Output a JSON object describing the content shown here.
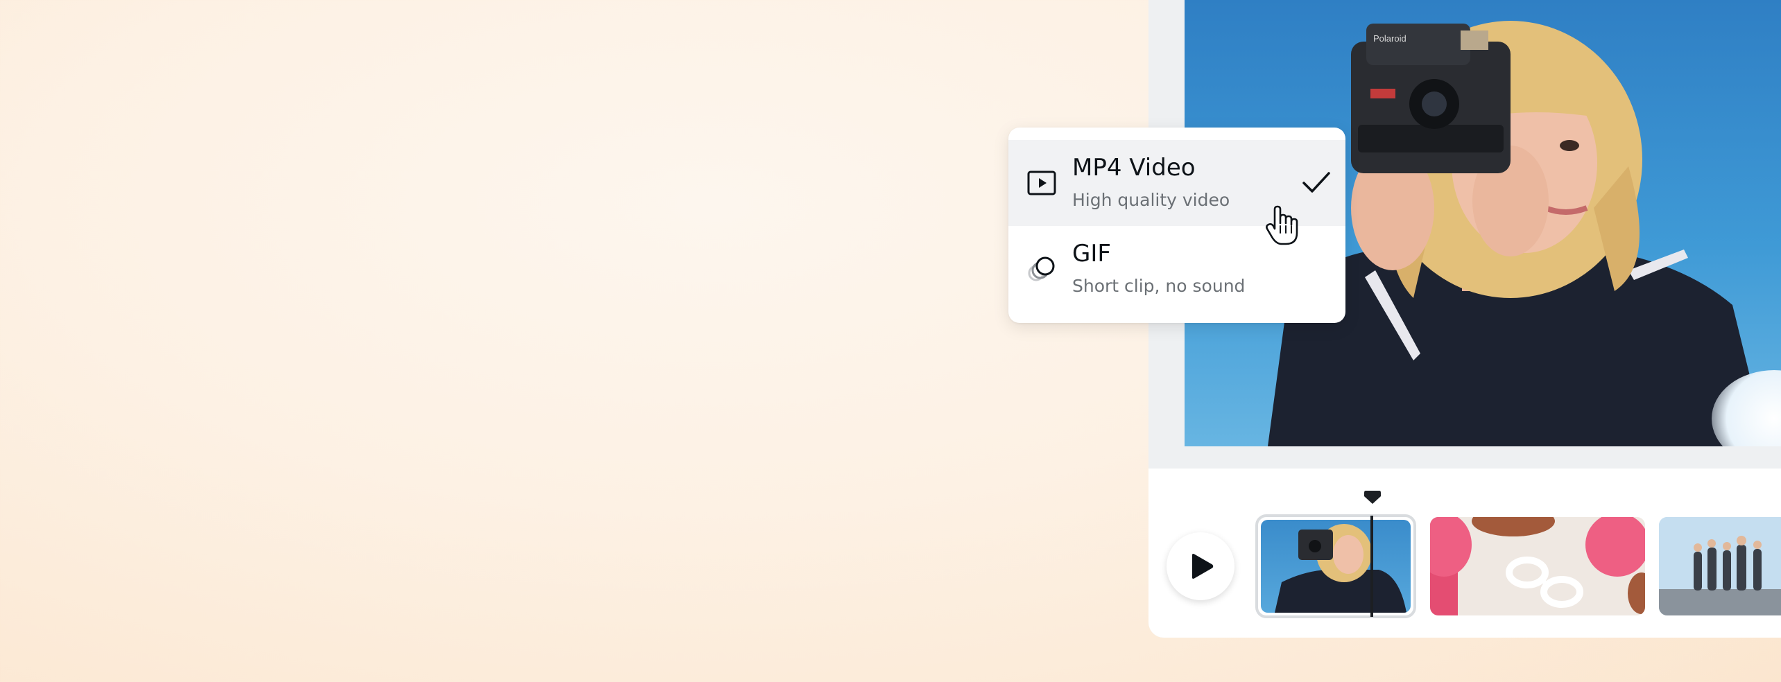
{
  "export_format_menu": {
    "options": [
      {
        "title": "MP4 Video",
        "subtitle": "High quality video",
        "icon": "play-square-icon",
        "selected": true
      },
      {
        "title": "GIF",
        "subtitle": "Short clip, no sound",
        "icon": "gif-circles-icon",
        "selected": false
      }
    ]
  },
  "preview": {
    "camera_brand_text": "Polaroid"
  },
  "timeline": {
    "play_button_icon": "play-icon",
    "clips": [
      {
        "subject": "woman-with-camera"
      },
      {
        "subject": "sunglasses-and-cups"
      },
      {
        "subject": "group-of-friends"
      }
    ]
  },
  "colors": {
    "background": "#fdf3e8",
    "panel": "#eef0f2",
    "selected_row": "#f1f2f4",
    "title_text": "#0e1318",
    "subtitle_text": "#6b7075"
  }
}
